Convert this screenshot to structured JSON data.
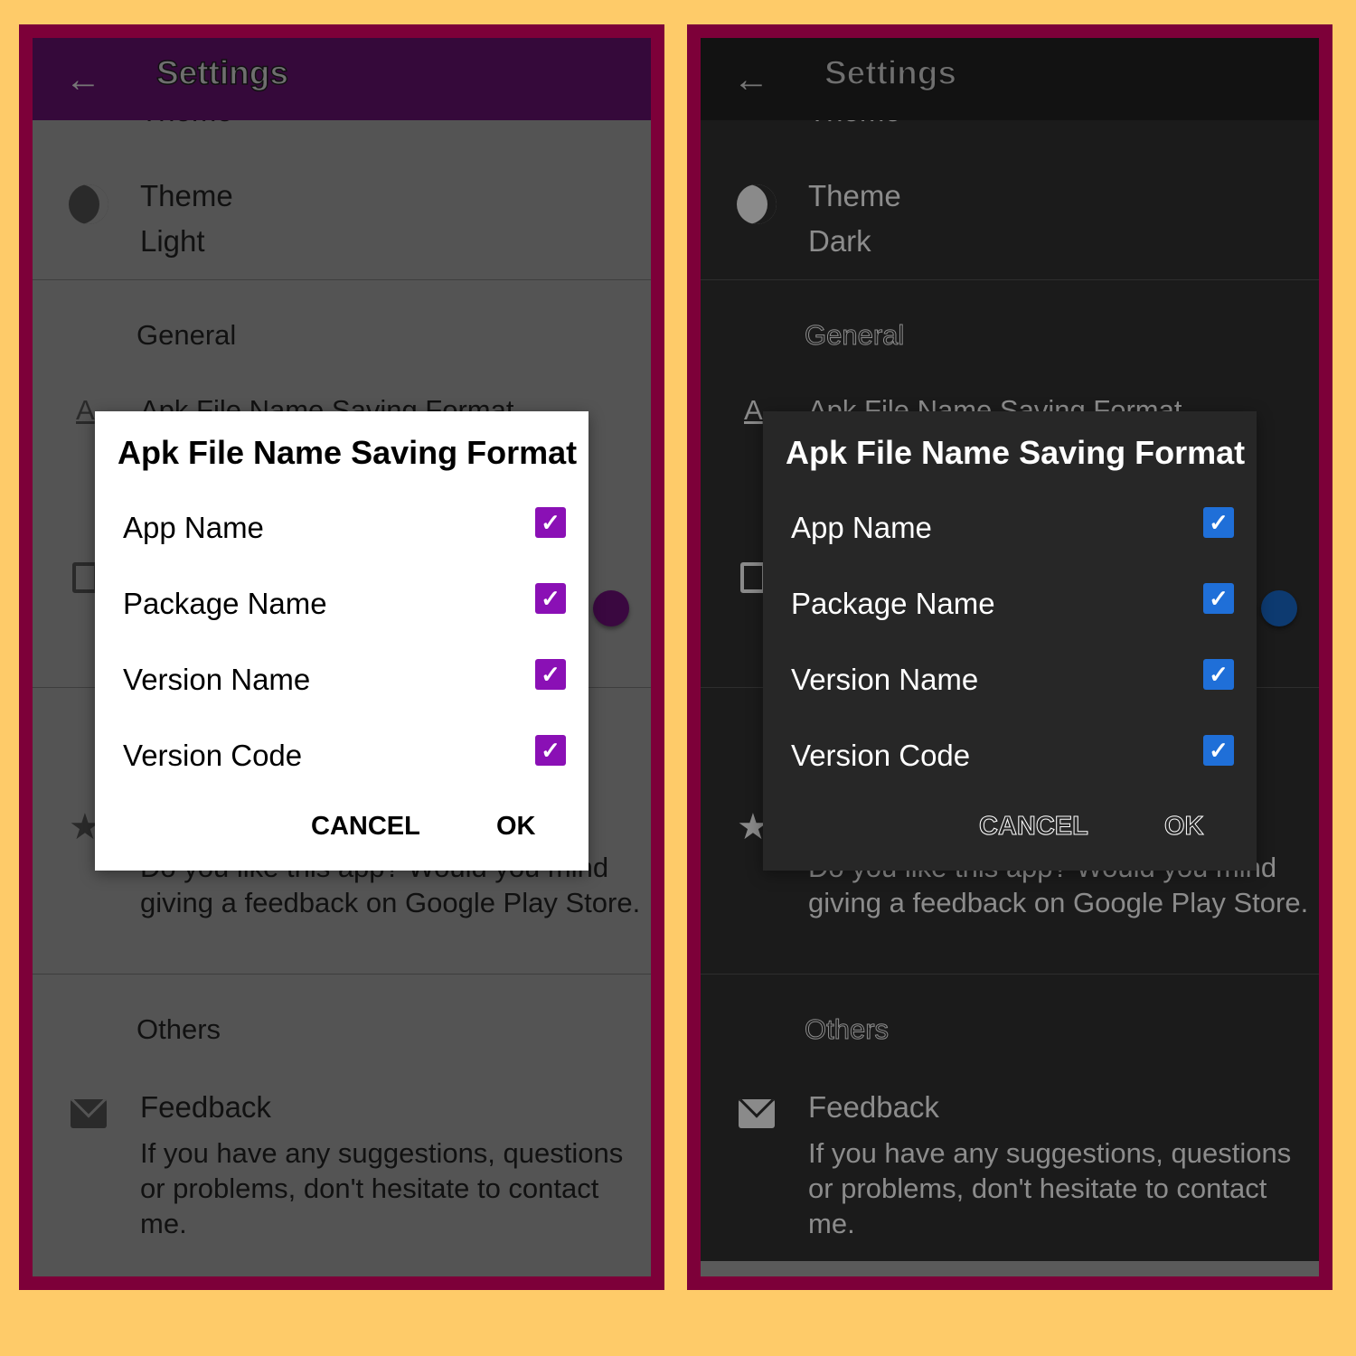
{
  "colors": {
    "background": "#fecb69",
    "frame": "#7d0039"
  },
  "panels": [
    {
      "theme": "light",
      "header_bg": "#35093a",
      "body_bg": "#545454",
      "text": "#111111",
      "divider": "#3e3e3e",
      "icon": "#2a2a2a",
      "accent": "#8a10b5",
      "toggle": "#3a0840",
      "dialog_bg": "#ffffff",
      "dialog_text": "#000000",
      "title_outline": false,
      "header": {
        "title": "Settings",
        "back_icon": "arrow-left-icon"
      },
      "categories": {
        "theme": "Theme",
        "general": "General",
        "others": "Others"
      },
      "theme_item": {
        "title": "Theme",
        "value": "Light"
      },
      "apk_item": {
        "title": "Apk File Name Saving Format"
      },
      "rate_item": {
        "desc": "Do you like this app? Would you mind giving a feedback on Google Play Store."
      },
      "feedback_item": {
        "title": "Feedback",
        "desc": "If you have any suggestions, questions or problems, don't hesitate to contact me."
      },
      "dialog": {
        "title": "Apk File Name Saving Format",
        "options": [
          {
            "label": "App Name",
            "checked": true
          },
          {
            "label": "Package Name",
            "checked": true
          },
          {
            "label": "Version Name",
            "checked": true
          },
          {
            "label": "Version Code",
            "checked": true
          }
        ],
        "cancel": "CANCEL",
        "ok": "OK"
      }
    },
    {
      "theme": "dark",
      "header_bg": "#121212",
      "body_bg": "#1b1b1b",
      "text": "#8c8c8c",
      "divider": "#2e2e2e",
      "icon": "#8a8a8a",
      "accent": "#1f6fd8",
      "toggle": "#0d3a70",
      "dialog_bg": "#272727",
      "dialog_text": "#ffffff",
      "title_outline": true,
      "header": {
        "title": "Settings",
        "back_icon": "arrow-left-icon"
      },
      "categories": {
        "theme": "Theme",
        "general": "General",
        "others": "Others"
      },
      "theme_item": {
        "title": "Theme",
        "value": "Dark"
      },
      "apk_item": {
        "title": "Apk File Name Saving Format"
      },
      "rate_item": {
        "desc": "Do you like this app? Would you mind giving a feedback on Google Play Store."
      },
      "feedback_item": {
        "title": "Feedback",
        "desc": "If you have any suggestions, questions or problems, don't hesitate to contact me."
      },
      "dialog": {
        "title": "Apk File Name Saving Format",
        "options": [
          {
            "label": "App Name",
            "checked": true
          },
          {
            "label": "Package Name",
            "checked": true
          },
          {
            "label": "Version Name",
            "checked": true
          },
          {
            "label": "Version Code",
            "checked": true
          }
        ],
        "cancel": "CANCEL",
        "ok": "OK"
      }
    }
  ]
}
